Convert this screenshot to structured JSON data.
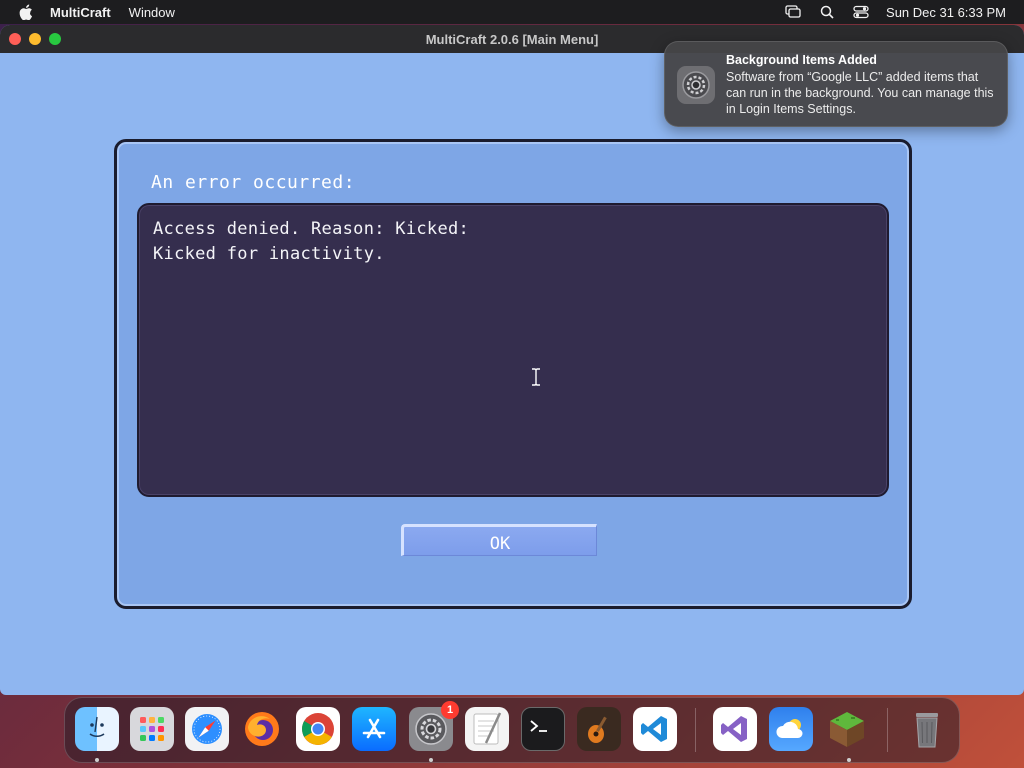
{
  "menubar": {
    "app_name": "MultiCraft",
    "items": [
      "Window"
    ],
    "datetime": "Sun Dec 31  6:33 PM"
  },
  "window": {
    "title": "MultiCraft 2.0.6 [Main Menu]"
  },
  "dialog": {
    "title": "An error occurred:",
    "message_lines": [
      "Access denied. Reason: Kicked:",
      "Kicked for inactivity."
    ],
    "ok_label": "OK"
  },
  "notification": {
    "title": "Background Items Added",
    "body": "Software from “Google LLC” added items that can run in the background. You can manage this in Login Items Settings."
  },
  "dock": {
    "items": [
      {
        "icon": "finder-icon",
        "running": true
      },
      {
        "icon": "launchpad-icon",
        "running": false
      },
      {
        "icon": "safari-icon",
        "running": false
      },
      {
        "icon": "firefox-icon",
        "running": false
      },
      {
        "icon": "chrome-icon",
        "running": false
      },
      {
        "icon": "app-store-icon",
        "running": false
      },
      {
        "icon": "system-settings-icon",
        "running": true,
        "badge": "1"
      },
      {
        "icon": "textedit-icon",
        "running": false
      },
      {
        "icon": "terminal-icon",
        "running": false
      },
      {
        "icon": "garageband-icon",
        "running": false
      },
      {
        "icon": "vscode-icon",
        "running": false
      },
      {
        "icon": "visual-studio-icon",
        "running": false
      },
      {
        "icon": "weather-icon",
        "running": false
      },
      {
        "icon": "multicraft-icon",
        "running": true
      },
      {
        "icon": "trash-icon",
        "running": false
      }
    ]
  },
  "colors": {
    "window_bg": "#8fb6f0",
    "dialog_bg": "#7ea6e6",
    "message_bg": "#352e4e",
    "button_bg": "#8ba9f0"
  }
}
